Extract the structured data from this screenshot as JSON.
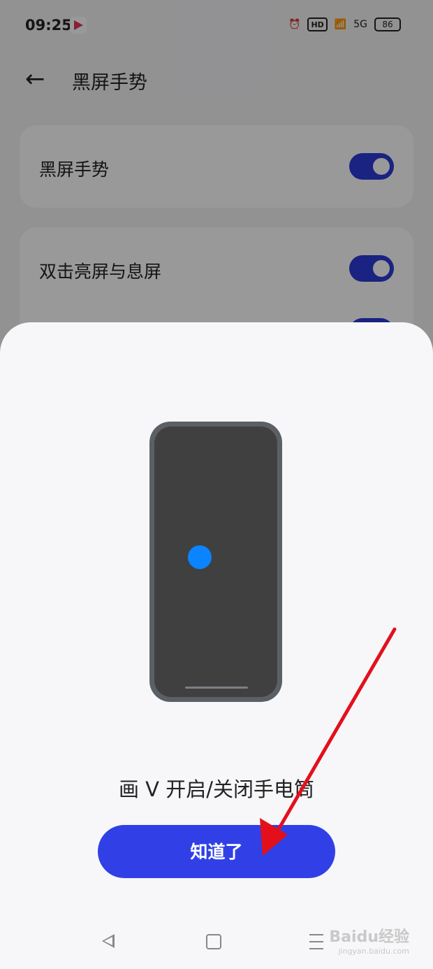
{
  "status_bar": {
    "time": "09:25",
    "hd": "HD",
    "network": "5G",
    "battery": "86"
  },
  "header": {
    "title": "黑屏手势"
  },
  "settings": {
    "main_toggle_label": "黑屏手势",
    "double_tap_label": "双击亮屏与息屏"
  },
  "sheet": {
    "caption": "画 V 开启/关闭手电筒",
    "ok_label": "知道了"
  },
  "watermark": {
    "brand": "Baidu经验",
    "url": "jingyan.baidu.com"
  },
  "colors": {
    "accent": "#3040e6",
    "dot": "#0a84ff",
    "arrow": "#e3101c"
  }
}
